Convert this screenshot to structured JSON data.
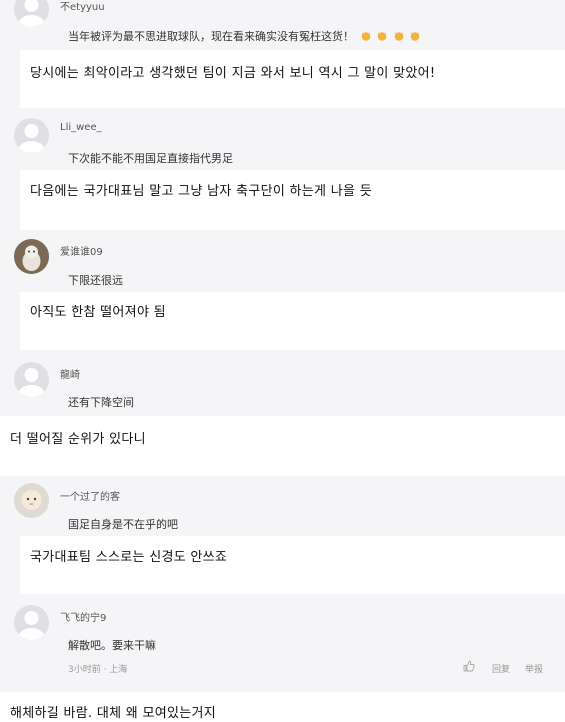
{
  "comments": [
    {
      "username": "不etyyuu",
      "text": "当年被评为最不思进取球队，现在看来确实没有冤枉这货！",
      "translation": "당시에는 최악이라고 생각했던 팀이 지금 와서 보니 역시 그 말이 맞았어!"
    },
    {
      "username": "Lli_wee_",
      "text": "下次能不能不用国足直接指代男足",
      "translation": "다음에는 국가대표님 말고 그냥 남자 축구단이 하는게 나을 듯"
    },
    {
      "username": "爱谁谁09",
      "text": "下限还很远",
      "translation": "아직도 한참 떨어져야 됨"
    },
    {
      "username": "龍崎",
      "text": "还有下降空间",
      "translation": "더 떨어질 순위가 있다니"
    },
    {
      "username": "一个过了的客",
      "text": "国足自身是不在乎的吧",
      "translation": "국가대표팀 스스로는 신경도 안쓰죠"
    },
    {
      "username": "飞飞的宁9",
      "text": "解散吧。要来干嘛",
      "time": "3小时前 · 上海",
      "reply_label": "回复",
      "report_label": "举报",
      "translation": "해체하길 바람. 대체 왜 모여있는거지"
    }
  ]
}
